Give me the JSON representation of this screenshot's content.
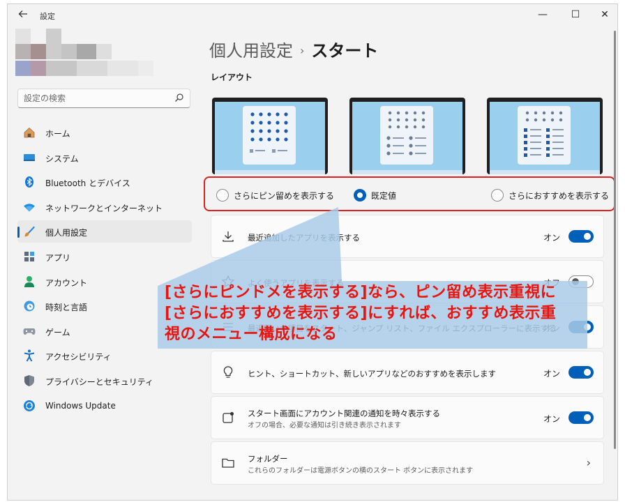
{
  "window": {
    "title": "設定",
    "controls": {
      "minimize": "—",
      "maximize": "☐",
      "close": "✕"
    }
  },
  "search": {
    "placeholder": "設定の検索"
  },
  "nav": {
    "items": [
      {
        "label": "ホーム",
        "icon": "home-icon"
      },
      {
        "label": "システム",
        "icon": "system-icon"
      },
      {
        "label": "Bluetooth とデバイス",
        "icon": "bluetooth-icon"
      },
      {
        "label": "ネットワークとインターネット",
        "icon": "network-icon"
      },
      {
        "label": "個人用設定",
        "icon": "brush-icon",
        "selected": true
      },
      {
        "label": "アプリ",
        "icon": "apps-icon"
      },
      {
        "label": "アカウント",
        "icon": "account-icon"
      },
      {
        "label": "時刻と言語",
        "icon": "time-language-icon"
      },
      {
        "label": "ゲーム",
        "icon": "gamepad-icon"
      },
      {
        "label": "アクセシビリティ",
        "icon": "accessibility-icon"
      },
      {
        "label": "プライバシーとセキュリティ",
        "icon": "shield-icon"
      },
      {
        "label": "Windows Update",
        "icon": "update-icon"
      }
    ]
  },
  "breadcrumb": {
    "parent": "個人用設定",
    "separator": "›",
    "current": "スタート"
  },
  "layout_section": {
    "title": "レイアウト",
    "options": [
      {
        "label": "さらにピン留めを表示する",
        "checked": false
      },
      {
        "label": "既定値",
        "checked": true
      },
      {
        "label": "さらにおすすめを表示する",
        "checked": false
      }
    ]
  },
  "settings": [
    {
      "title": "最近追加したアプリを表示する",
      "state_label": "オン",
      "on": true,
      "icon": "download-icon"
    },
    {
      "title": "よく使うアプリを表示する",
      "state_label": "オフ",
      "on": false,
      "icon": "star-icon"
    },
    {
      "title": "最近開いた項目をスタート、ジャンプ リスト、ファイル エクスプローラーに表示する",
      "state_label": "オン",
      "on": true,
      "icon": "list-icon"
    },
    {
      "title": "ヒント、ショートカット、新しいアプリなどのおすすめを表示します",
      "state_label": "オン",
      "on": true,
      "icon": "lightbulb-icon"
    },
    {
      "title": "スタート画面にアカウント関連の通知を時々表示する",
      "subtitle": "オフの場合、必要な通知は引き続き表示されます",
      "state_label": "オン",
      "on": true,
      "icon": "notification-icon"
    },
    {
      "title": "フォルダー",
      "subtitle": "これらのフォルダーは電源ボタンの横のスタート ボタンに表示されます",
      "icon": "folder-icon",
      "chevron": "›"
    }
  ],
  "annotation": {
    "lines": [
      "[さらにピンドメを表示する]なら、ピン留め表示重視に",
      "[さらにおすすめを表示する]にすれば、おすすめ表示重",
      "視のメニュー構成になる"
    ]
  },
  "colors": {
    "accent": "#005fb8",
    "annotation_text": "#e8150f",
    "annotation_box": "#a9cbe8",
    "highlight_border": "#e02020"
  }
}
